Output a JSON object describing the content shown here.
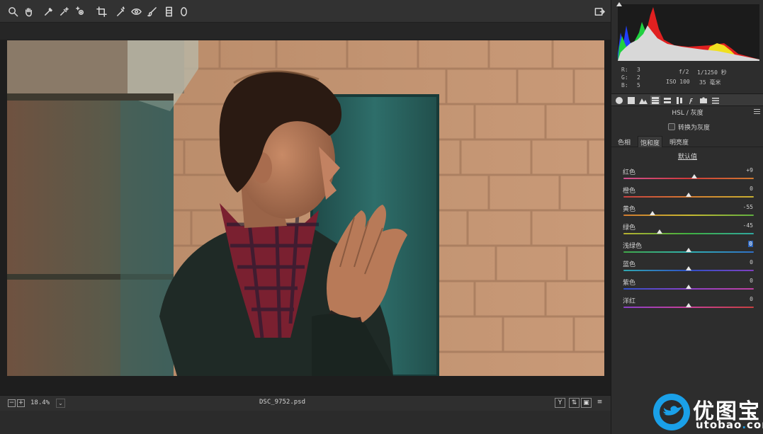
{
  "toolbar": {
    "tools": [
      "zoom-icon",
      "hand-icon",
      "white-balance-icon",
      "color-sampler-icon",
      "targeted-adjustment-icon",
      "crop-icon",
      "spot-removal-icon",
      "red-eye-icon",
      "adjustment-brush-icon",
      "graduated-filter-icon",
      "radial-filter-icon"
    ],
    "fullscreen_icon": "open-fullscreen-icon"
  },
  "status": {
    "zoom": "18.4%",
    "filename": "DSC_9752.psd",
    "right_buttons": [
      "Y",
      "⇅",
      "▣",
      "≡"
    ]
  },
  "readout": {
    "r_label": "R:",
    "r_value": "3",
    "g_label": "G:",
    "g_value": "2",
    "b_label": "B:",
    "b_value": "5",
    "aperture": "f/2",
    "shutter": "1/1250 秒",
    "iso": "ISO 100",
    "focal": "35 毫米"
  },
  "panel": {
    "title": "HSL / 灰度",
    "grayscale_label": "转换为灰度",
    "subtabs": [
      "色相",
      "饱和度",
      "明亮度"
    ],
    "default_link": "默认值",
    "sliders": [
      {
        "label": "红色",
        "value": "+9",
        "level": 9,
        "gradient": [
          "#d05090",
          "#d03a3a",
          "#d07a30"
        ]
      },
      {
        "label": "橙色",
        "value": "0",
        "level": 0,
        "gradient": [
          "#c84040",
          "#d47a30",
          "#c8b030"
        ]
      },
      {
        "label": "黄色",
        "value": "-55",
        "level": -55,
        "gradient": [
          "#d07a30",
          "#c8b830",
          "#60b040"
        ]
      },
      {
        "label": "绿色",
        "value": "-45",
        "level": -45,
        "gradient": [
          "#b8b030",
          "#40b040",
          "#30a8a0"
        ]
      },
      {
        "label": "浅绿色",
        "value": "0",
        "level": 0,
        "gradient": [
          "#40a848",
          "#30b0b0",
          "#3070c8"
        ],
        "focused": true
      },
      {
        "label": "蓝色",
        "value": "0",
        "level": 0,
        "gradient": [
          "#30a8b0",
          "#3050c8",
          "#8040c0"
        ]
      },
      {
        "label": "紫色",
        "value": "0",
        "level": 0,
        "gradient": [
          "#3050c8",
          "#8a40c8",
          "#c040a0"
        ]
      },
      {
        "label": "洋红",
        "value": "0",
        "level": 0,
        "gradient": [
          "#8a40c8",
          "#c84098",
          "#c84040"
        ]
      }
    ]
  },
  "watermark": {
    "cn": "优图宝",
    "url_a": "utobao",
    "url_dot": ".",
    "url_b": "com"
  }
}
